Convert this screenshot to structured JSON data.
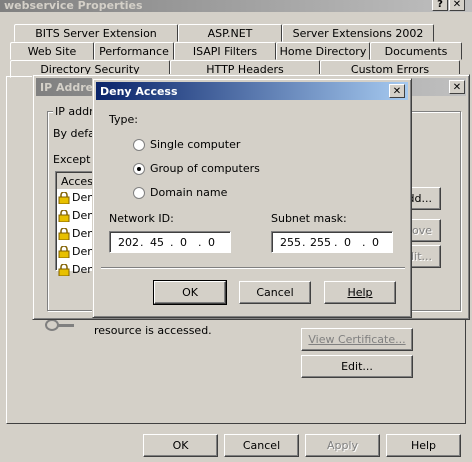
{
  "window": {
    "title": "webservice Properties"
  },
  "tabs_row1": [
    "BITS Server Extension",
    "ASP.NET",
    "Server Extensions 2002"
  ],
  "tabs_row2": [
    "Web Site",
    "Performance",
    "ISAPI Filters",
    "Home Directory",
    "Documents"
  ],
  "tabs_row3": [
    "Directory Security",
    "HTTP Headers",
    "Custom Errors"
  ],
  "ip_dialog": {
    "title_fragment": "IP Address",
    "group_fragment": "IP addre",
    "default_fragment": "By defa",
    "except_label": "Except",
    "list_header": "Acces",
    "list_rows": [
      "Den",
      "Den",
      "Den",
      "Den",
      "Den"
    ],
    "add_btn": "dd...",
    "remove_btn": "move",
    "edit_btn": "dit..."
  },
  "bg_content": {
    "resource_text": "resource is accessed.",
    "view_cert_btn": "View Certificate...",
    "edit_btn": "Edit..."
  },
  "footer": {
    "ok": "OK",
    "cancel": "Cancel",
    "apply": "Apply",
    "help": "Help"
  },
  "deny": {
    "title": "Deny Access",
    "type_label": "Type:",
    "opt_single": "Single computer",
    "opt_group": "Group of computers",
    "opt_domain": "Domain name",
    "network_label": "Network ID:",
    "subnet_label": "Subnet mask:",
    "network_ip": [
      "202",
      "45",
      "0",
      "0"
    ],
    "subnet_ip": [
      "255",
      "255",
      "0",
      "0"
    ],
    "ok": "OK",
    "cancel": "Cancel",
    "help": "Help"
  }
}
